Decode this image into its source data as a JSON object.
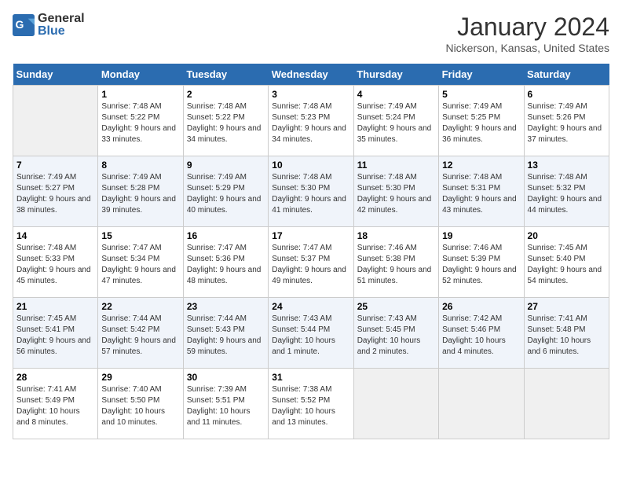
{
  "header": {
    "logo_general": "General",
    "logo_blue": "Blue",
    "month_title": "January 2024",
    "location": "Nickerson, Kansas, United States"
  },
  "days_of_week": [
    "Sunday",
    "Monday",
    "Tuesday",
    "Wednesday",
    "Thursday",
    "Friday",
    "Saturday"
  ],
  "weeks": [
    [
      {
        "day": "",
        "empty": true
      },
      {
        "day": "1",
        "sunrise": "Sunrise: 7:48 AM",
        "sunset": "Sunset: 5:22 PM",
        "daylight": "Daylight: 9 hours and 33 minutes."
      },
      {
        "day": "2",
        "sunrise": "Sunrise: 7:48 AM",
        "sunset": "Sunset: 5:22 PM",
        "daylight": "Daylight: 9 hours and 34 minutes."
      },
      {
        "day": "3",
        "sunrise": "Sunrise: 7:48 AM",
        "sunset": "Sunset: 5:23 PM",
        "daylight": "Daylight: 9 hours and 34 minutes."
      },
      {
        "day": "4",
        "sunrise": "Sunrise: 7:49 AM",
        "sunset": "Sunset: 5:24 PM",
        "daylight": "Daylight: 9 hours and 35 minutes."
      },
      {
        "day": "5",
        "sunrise": "Sunrise: 7:49 AM",
        "sunset": "Sunset: 5:25 PM",
        "daylight": "Daylight: 9 hours and 36 minutes."
      },
      {
        "day": "6",
        "sunrise": "Sunrise: 7:49 AM",
        "sunset": "Sunset: 5:26 PM",
        "daylight": "Daylight: 9 hours and 37 minutes."
      }
    ],
    [
      {
        "day": "7",
        "sunrise": "Sunrise: 7:49 AM",
        "sunset": "Sunset: 5:27 PM",
        "daylight": "Daylight: 9 hours and 38 minutes."
      },
      {
        "day": "8",
        "sunrise": "Sunrise: 7:49 AM",
        "sunset": "Sunset: 5:28 PM",
        "daylight": "Daylight: 9 hours and 39 minutes."
      },
      {
        "day": "9",
        "sunrise": "Sunrise: 7:49 AM",
        "sunset": "Sunset: 5:29 PM",
        "daylight": "Daylight: 9 hours and 40 minutes."
      },
      {
        "day": "10",
        "sunrise": "Sunrise: 7:48 AM",
        "sunset": "Sunset: 5:30 PM",
        "daylight": "Daylight: 9 hours and 41 minutes."
      },
      {
        "day": "11",
        "sunrise": "Sunrise: 7:48 AM",
        "sunset": "Sunset: 5:30 PM",
        "daylight": "Daylight: 9 hours and 42 minutes."
      },
      {
        "day": "12",
        "sunrise": "Sunrise: 7:48 AM",
        "sunset": "Sunset: 5:31 PM",
        "daylight": "Daylight: 9 hours and 43 minutes."
      },
      {
        "day": "13",
        "sunrise": "Sunrise: 7:48 AM",
        "sunset": "Sunset: 5:32 PM",
        "daylight": "Daylight: 9 hours and 44 minutes."
      }
    ],
    [
      {
        "day": "14",
        "sunrise": "Sunrise: 7:48 AM",
        "sunset": "Sunset: 5:33 PM",
        "daylight": "Daylight: 9 hours and 45 minutes."
      },
      {
        "day": "15",
        "sunrise": "Sunrise: 7:47 AM",
        "sunset": "Sunset: 5:34 PM",
        "daylight": "Daylight: 9 hours and 47 minutes."
      },
      {
        "day": "16",
        "sunrise": "Sunrise: 7:47 AM",
        "sunset": "Sunset: 5:36 PM",
        "daylight": "Daylight: 9 hours and 48 minutes."
      },
      {
        "day": "17",
        "sunrise": "Sunrise: 7:47 AM",
        "sunset": "Sunset: 5:37 PM",
        "daylight": "Daylight: 9 hours and 49 minutes."
      },
      {
        "day": "18",
        "sunrise": "Sunrise: 7:46 AM",
        "sunset": "Sunset: 5:38 PM",
        "daylight": "Daylight: 9 hours and 51 minutes."
      },
      {
        "day": "19",
        "sunrise": "Sunrise: 7:46 AM",
        "sunset": "Sunset: 5:39 PM",
        "daylight": "Daylight: 9 hours and 52 minutes."
      },
      {
        "day": "20",
        "sunrise": "Sunrise: 7:45 AM",
        "sunset": "Sunset: 5:40 PM",
        "daylight": "Daylight: 9 hours and 54 minutes."
      }
    ],
    [
      {
        "day": "21",
        "sunrise": "Sunrise: 7:45 AM",
        "sunset": "Sunset: 5:41 PM",
        "daylight": "Daylight: 9 hours and 56 minutes."
      },
      {
        "day": "22",
        "sunrise": "Sunrise: 7:44 AM",
        "sunset": "Sunset: 5:42 PM",
        "daylight": "Daylight: 9 hours and 57 minutes."
      },
      {
        "day": "23",
        "sunrise": "Sunrise: 7:44 AM",
        "sunset": "Sunset: 5:43 PM",
        "daylight": "Daylight: 9 hours and 59 minutes."
      },
      {
        "day": "24",
        "sunrise": "Sunrise: 7:43 AM",
        "sunset": "Sunset: 5:44 PM",
        "daylight": "Daylight: 10 hours and 1 minute."
      },
      {
        "day": "25",
        "sunrise": "Sunrise: 7:43 AM",
        "sunset": "Sunset: 5:45 PM",
        "daylight": "Daylight: 10 hours and 2 minutes."
      },
      {
        "day": "26",
        "sunrise": "Sunrise: 7:42 AM",
        "sunset": "Sunset: 5:46 PM",
        "daylight": "Daylight: 10 hours and 4 minutes."
      },
      {
        "day": "27",
        "sunrise": "Sunrise: 7:41 AM",
        "sunset": "Sunset: 5:48 PM",
        "daylight": "Daylight: 10 hours and 6 minutes."
      }
    ],
    [
      {
        "day": "28",
        "sunrise": "Sunrise: 7:41 AM",
        "sunset": "Sunset: 5:49 PM",
        "daylight": "Daylight: 10 hours and 8 minutes."
      },
      {
        "day": "29",
        "sunrise": "Sunrise: 7:40 AM",
        "sunset": "Sunset: 5:50 PM",
        "daylight": "Daylight: 10 hours and 10 minutes."
      },
      {
        "day": "30",
        "sunrise": "Sunrise: 7:39 AM",
        "sunset": "Sunset: 5:51 PM",
        "daylight": "Daylight: 10 hours and 11 minutes."
      },
      {
        "day": "31",
        "sunrise": "Sunrise: 7:38 AM",
        "sunset": "Sunset: 5:52 PM",
        "daylight": "Daylight: 10 hours and 13 minutes."
      },
      {
        "day": "",
        "empty": true
      },
      {
        "day": "",
        "empty": true
      },
      {
        "day": "",
        "empty": true
      }
    ]
  ]
}
